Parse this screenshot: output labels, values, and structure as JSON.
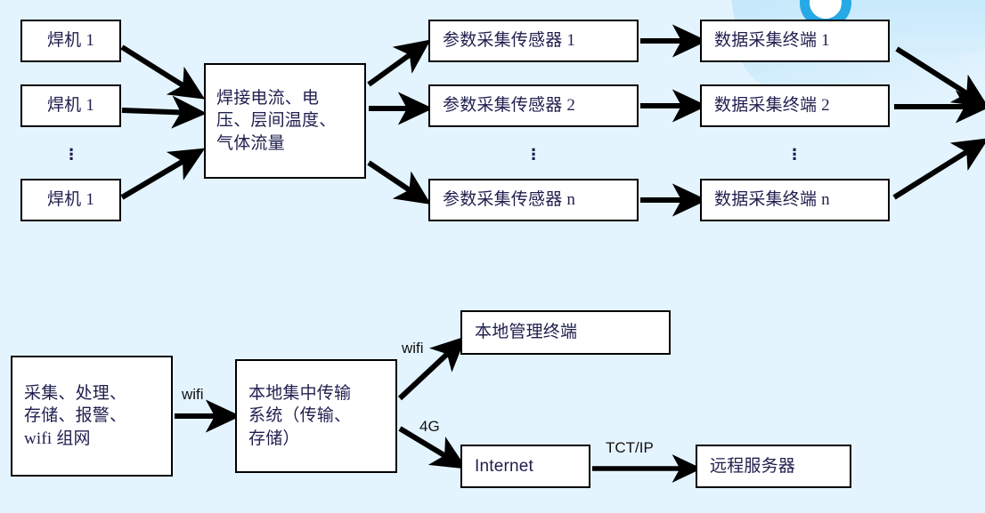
{
  "diagram": {
    "title_text": "",
    "background_color": "#e4f4fe",
    "box_fill": "#ffffff",
    "box_border": "#000000",
    "text_color": "#1f1f4f",
    "accent_color": "#27a9e6",
    "ellipsis": "⋮"
  },
  "top_section": {
    "welders": [
      {
        "label": "焊机 1"
      },
      {
        "label": "焊机 1"
      },
      {
        "label": "焊机 1"
      }
    ],
    "aggregator": {
      "label": "焊接电流、电\n压、层间温度、\n气体流量"
    },
    "sensors": [
      {
        "label": "参数采集传感器 1"
      },
      {
        "label": "参数采集传感器 2"
      },
      {
        "label": "参数采集传感器 n"
      }
    ],
    "terminals": [
      {
        "label": "数据采集终端 1"
      },
      {
        "label": "数据采集终端 2"
      },
      {
        "label": "数据采集终端 n"
      }
    ]
  },
  "bottom_section": {
    "collector": {
      "label": "采集、处理、\n存储、报警、\nwifi 组网"
    },
    "transmission": {
      "label": "本地集中传输\n系统（传输、\n存储）"
    },
    "local_terminal": {
      "label": "本地管理终端"
    },
    "internet": {
      "label": "Internet"
    },
    "remote_server": {
      "label": "远程服务器"
    },
    "edge_labels": {
      "collector_to_transmission": "wifi",
      "transmission_to_local": "wifi",
      "transmission_to_internet": "4G",
      "internet_to_server": "TCT/IP"
    }
  }
}
